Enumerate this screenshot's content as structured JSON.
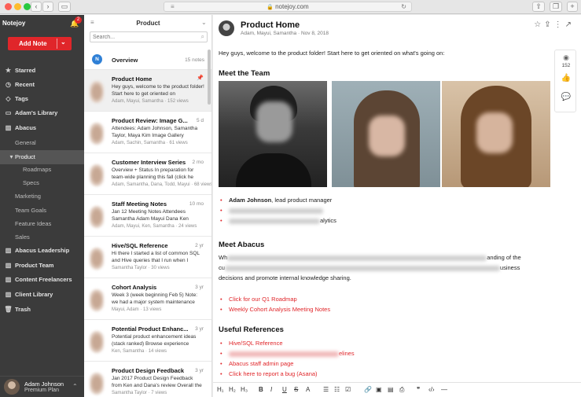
{
  "browser": {
    "url": "notejoy.com"
  },
  "sidebar": {
    "app_name": "Notejoy",
    "notification_count": "2",
    "add_note_label": "Add Note",
    "items": [
      {
        "label": "Starred",
        "icon": "star-icon",
        "level": 0,
        "bold": true
      },
      {
        "label": "Recent",
        "icon": "clock-icon",
        "level": 0,
        "bold": true
      },
      {
        "label": "Tags",
        "icon": "tag-icon",
        "level": 0,
        "bold": true
      },
      {
        "label": "Adam's Library",
        "icon": "folder-icon",
        "level": 0,
        "bold": true
      },
      {
        "label": "Abacus",
        "icon": "library-icon",
        "level": 0,
        "bold": true
      },
      {
        "label": "General",
        "level": 1
      },
      {
        "label": "Product",
        "level": 1,
        "active": true,
        "expanded": true
      },
      {
        "label": "Roadmaps",
        "level": 2
      },
      {
        "label": "Specs",
        "level": 2
      },
      {
        "label": "Marketing",
        "level": 1
      },
      {
        "label": "Team Goals",
        "level": 1
      },
      {
        "label": "Feature Ideas",
        "level": 1
      },
      {
        "label": "Sales",
        "level": 1
      },
      {
        "label": "Abacus Leadership",
        "icon": "library-icon",
        "level": 0,
        "bold": true
      },
      {
        "label": "Product Team",
        "icon": "library-icon",
        "level": 0,
        "bold": true
      },
      {
        "label": "Content Freelancers",
        "icon": "library-icon",
        "level": 0,
        "bold": true
      },
      {
        "label": "Client Library",
        "icon": "library-icon",
        "level": 0,
        "bold": true
      },
      {
        "label": "Trash",
        "icon": "trash-icon",
        "level": 0,
        "bold": true
      }
    ],
    "user": {
      "name": "Adam Johnson",
      "plan": "Premium Plan"
    }
  },
  "notelist": {
    "title": "Product",
    "search_placeholder": "Search...",
    "overview": {
      "badge": "N",
      "label": "Overview",
      "count": "15 notes"
    },
    "notes": [
      {
        "title": "Product Home",
        "ago": "",
        "pinned": true,
        "excerpt": "Hey guys, welcome to the product folder! Start here to get oriented on",
        "meta": "Adam, Mayui, Samantha · 152 views",
        "active": true
      },
      {
        "title": "Product Review: Image G...",
        "ago": "5 d",
        "excerpt": "Attendees: Adam Johnson, Samantha Taylor, Maya Kim Image Gallery",
        "meta": "Adam, Sachin, Samantha · 61 views"
      },
      {
        "title": "Customer Interview Series",
        "ago": "2 mo",
        "excerpt": "Overview + Status In preparation for team-wide planning this fall (click he",
        "meta": "Adam, Samantha, Dana, Todd, Mayui · 68 views"
      },
      {
        "title": "Staff Meeting Notes",
        "ago": "10 mo",
        "excerpt": "Jan 12 Meeting Notes Attendees Samantha Adam Mayui Dana Ken",
        "meta": "Adam, Mayui, Ken, Samantha · 24 views"
      },
      {
        "title": "Hive/SQL Reference",
        "ago": "2 yr",
        "excerpt": "Hi there I started a list of common SQL and Hive queries that I run when I",
        "meta": "Samantha Taylor · 30 views"
      },
      {
        "title": "Cohort Analysis",
        "ago": "3 yr",
        "excerpt": "Week 3 (week beginning Feb 5) Note: we had a major system maintenance",
        "meta": "Mayui, Adam · 13 views"
      },
      {
        "title": "Potential Product Enhanc...",
        "ago": "3 yr",
        "excerpt": "Potential product enhancement ideas (stack ranked) Browse experience",
        "meta": "Ken, Samantha · 14 views"
      },
      {
        "title": "Product Design Feedback",
        "ago": "3 yr",
        "excerpt": "Jan 2017 Product Design Feedback from Ken and Dana's review Overall the",
        "meta": "Samantha Taylor · 7 views"
      }
    ]
  },
  "editor": {
    "title": "Product Home",
    "meta": "Adam, Mayui, Samantha · Nov 8, 2018",
    "intro": "Hey guys, welcome to the product folder! Start here to get oriented on what's going on:",
    "meet_team_heading": "Meet the Team",
    "team_bullets": [
      {
        "bold": "Adam Johnson",
        "rest": ", lead product manager"
      },
      {
        "bold": "",
        "rest": ""
      },
      {
        "bold": "",
        "rest": "alytics"
      }
    ],
    "meet_abacus_heading": "Meet Abacus",
    "abacus_line1_start": "Wh",
    "abacus_line1_end": "anding of the",
    "abacus_line2_start": "cu",
    "abacus_line2_end": "usiness",
    "abacus_line3": "decisions and promote internal knowledge sharing.",
    "abacus_links": [
      "Click for our Q1 Roadmap",
      "Weekly Cohort Analysis Meeting Notes"
    ],
    "refs_heading": "Useful References",
    "ref_links": [
      "Hive/SQL Reference",
      "",
      "Abacus staff admin page",
      "Click here to report a bug (Asana)"
    ],
    "ref_link2_end": "elines",
    "toolbar": [
      "H₁",
      "H₂",
      "H₃",
      "B",
      "I",
      "U",
      "S",
      "A",
      "☰",
      "☷",
      "☑",
      "🔗",
      "▣",
      "▤",
      "⎙",
      "❞",
      "‹/›",
      "—"
    ],
    "views": "152"
  }
}
